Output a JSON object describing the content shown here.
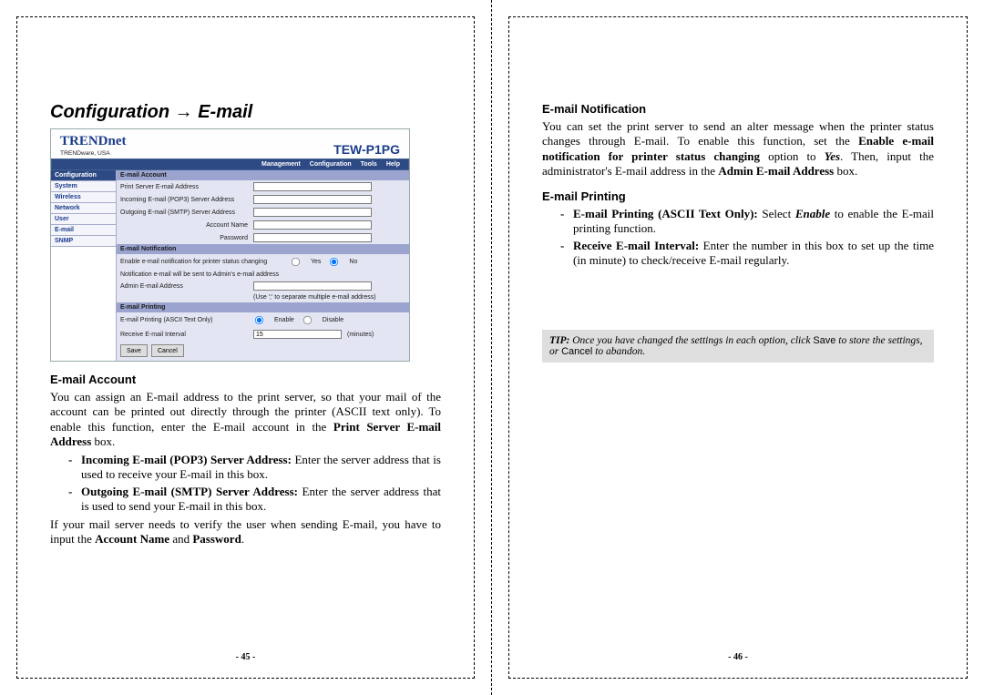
{
  "left": {
    "title": "Configuration → E-mail",
    "screenshot": {
      "brand": "TRENDnet",
      "brand_sub": "TRENDware, USA",
      "model": "TEW-P1PG",
      "menu": [
        "Management",
        "Configuration",
        "Tools",
        "Help"
      ],
      "sidebar_head": "Configuration",
      "sidebar_items": [
        "System",
        "Wireless",
        "Network",
        "User",
        "E-mail",
        "SNMP"
      ],
      "sec_account": "E-mail Account",
      "lbl_ps_addr": "Print Server E-mail Address",
      "lbl_pop3": "Incoming E-mail (POP3) Server Address",
      "lbl_smtp": "Outgoing E-mail (SMTP) Server Address",
      "lbl_acct": "Account Name",
      "lbl_pass": "Password",
      "sec_notif": "E-mail Notification",
      "lbl_enable_notif": "Enable e-mail notification for printer status changing",
      "opt_yes": "Yes",
      "opt_no": "No",
      "lbl_notif_note": "Notification e-mail will be sent to Admin's e-mail address",
      "lbl_admin_addr": "Admin E-mail Address",
      "lbl_admin_hint": "(Use ';' to separate multiple e-mail address)",
      "sec_print": "E-mail Printing",
      "lbl_eprint": "E-mail Printing (ASCII Text Only)",
      "opt_enable": "Enable",
      "opt_disable": "Disable",
      "lbl_interval": "Receive E-mail Interval",
      "val_interval": "15",
      "lbl_minutes": "(minutes)",
      "btn_save": "Save",
      "btn_cancel": "Cancel"
    },
    "h_account": "E-mail Account",
    "p_account": "You can assign an E-mail address to the print server, so that your mail of the account can be printed out directly through the printer (ASCII text only).  To enable this function, enter the E-mail account in the ",
    "p_account_bold": "Print Server E-mail Address",
    "p_account_tail": " box.",
    "li1_bold": "Incoming E-mail (POP3) Server Address:",
    "li1_tail": " Enter the server address that is used to receive your E-mail in this box.",
    "li2_bold": "Outgoing E-mail (SMTP) Server Address:",
    "li2_tail": " Enter the server address that is used to send your E-mail in this box.",
    "p_verify_a": "If your mail server needs to verify the user when sending E-mail, you have to input the ",
    "p_verify_b": "Account Name",
    "p_verify_c": " and ",
    "p_verify_d": "Password",
    "p_verify_e": ".",
    "pagenum": "- 45 -"
  },
  "right": {
    "h_notif": "E-mail Notification",
    "p_notif_a": "You can set the print server to send an alter message when the printer status changes through E-mail.  To enable this function, set the ",
    "p_notif_b": "Enable e-mail notification for printer status changing",
    "p_notif_c": " option to ",
    "p_notif_d": "Yes",
    "p_notif_e": ".   Then, input the administrator's E-mail address in the ",
    "p_notif_f": "Admin E-mail Address",
    "p_notif_g": " box.",
    "h_print": "E-mail Printing",
    "li1_bold": "E-mail Printing (ASCII Text Only):",
    "li1_mid": " Select ",
    "li1_ital": "Enable",
    "li1_tail": " to enable the E-mail printing function.",
    "li2_bold": "Receive E-mail Interval:",
    "li2_tail": " Enter the number in this box to set up the time (in minute) to check/receive E-mail regularly.",
    "tip_lead": "TIP:",
    "tip_a": " Once you have changed the settings in each option, click ",
    "tip_save": "Save",
    "tip_b": " to store the settings, or ",
    "tip_cancel": "Cancel",
    "tip_c": " to abandon.",
    "pagenum": "- 46 -"
  }
}
